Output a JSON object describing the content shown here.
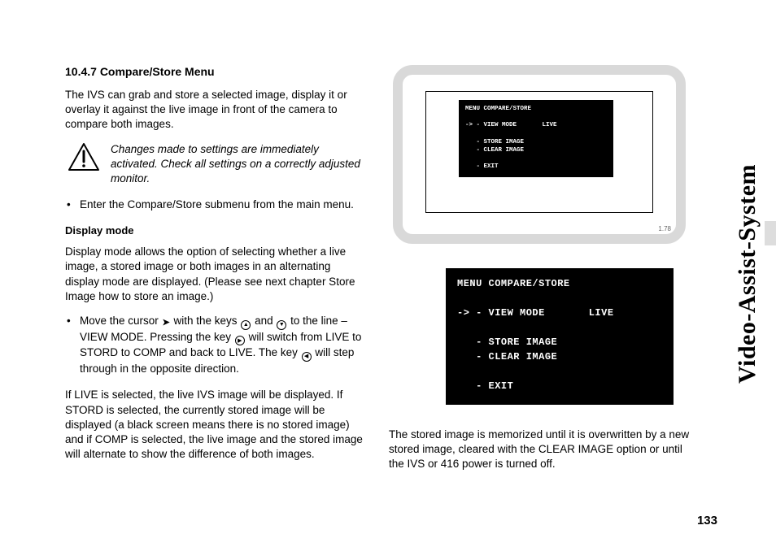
{
  "sideTitle": "Video-Assist-System",
  "pageNumber": "133",
  "section": {
    "heading": "10.4.7 Compare/Store Menu",
    "intro": "The IVS can grab and store a selected image, display it or overlay it against the live image in front of the camera to compare both images.",
    "warning": "Changes made to settings are immediately activated. Check all settings on a correctly adjusted monitor.",
    "bullet1": "Enter the Compare/Store submenu from the main menu.",
    "subHeading": "Display mode",
    "displayModePara": "Display mode allows the option of selecting whether a live image, a stored image or both images in an alternating display mode are displayed. (Please see next chapter Store Image how to store an image.)",
    "bullet2_prefix": "Move the cursor ",
    "bullet2_mid1": " with the keys ",
    "bullet2_mid2": " and ",
    "bullet2_mid3": " to the line – VIEW MODE. Pressing the key ",
    "bullet2_mid4": " will switch from LIVE to STORD to COMP and back to LIVE. The key ",
    "bullet2_suffix": " will step through in the opposite direction.",
    "livePara": "If LIVE is selected, the live IVS image will be displayed. If STORD is selected, the currently stored image will be displayed (a black screen means there is no stored image) and if COMP is selected, the live image and the stored image will alternate to show the difference of both images."
  },
  "menu": {
    "title": "MENU COMPARE/STORE",
    "lineViewMode": "-> - VIEW MODE       LIVE",
    "lineStore": "   - STORE IMAGE",
    "lineClear": "   - CLEAR IMAGE",
    "lineExit": "   - EXIT"
  },
  "deviceLabel": "1.78",
  "rightPara": "The stored image is memorized until it is overwritten by a new stored image, cleared with the CLEAR IMAGE option or until the IVS or 416 power is turned off."
}
